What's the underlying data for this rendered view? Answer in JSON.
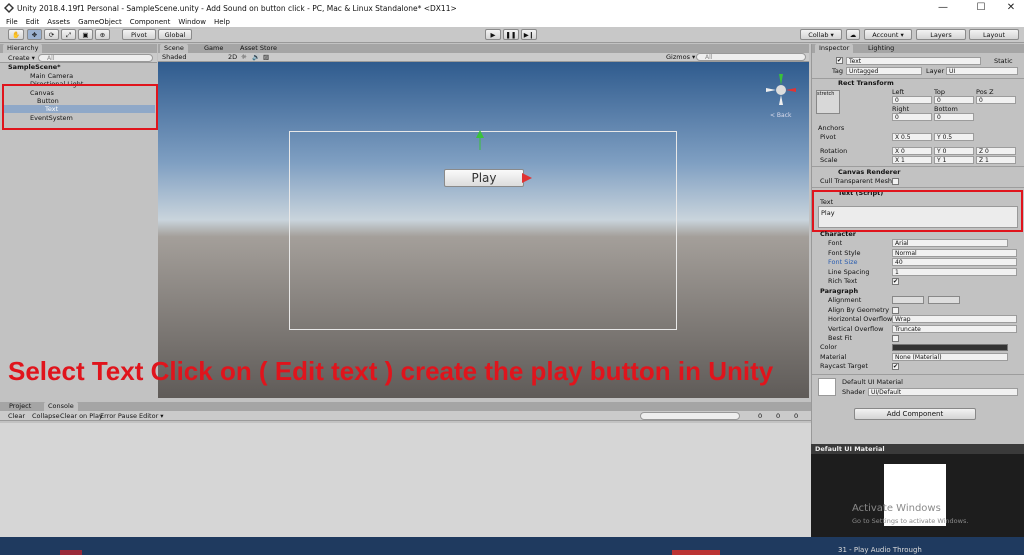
{
  "window": {
    "title": "Unity 2018.4.19f1 Personal - SampleScene.unity - Add Sound on button click - PC, Mac & Linux Standalone* <DX11>",
    "minimize": "—",
    "maximize": "☐",
    "close": "✕"
  },
  "menu": [
    "File",
    "Edit",
    "Assets",
    "GameObject",
    "Component",
    "Window",
    "Help"
  ],
  "toolbar": {
    "pivot": "Pivot",
    "global": "Global",
    "collab": "Collab ▾",
    "account": "Account ▾",
    "layers": "Layers",
    "layout": "Layout"
  },
  "hierarchy": {
    "tab": "Hierarchy",
    "create": "Create ▾",
    "search_placeholder": "All",
    "scene": "SampleScene*",
    "items": [
      {
        "label": "Main Camera",
        "indent": 1,
        "selected": false
      },
      {
        "label": "Directional Light",
        "indent": 1,
        "selected": false
      },
      {
        "label": "Canvas",
        "indent": 1,
        "selected": false
      },
      {
        "label": "Button",
        "indent": 2,
        "selected": false
      },
      {
        "label": "Text",
        "indent": 3,
        "selected": true
      },
      {
        "label": "EventSystem",
        "indent": 1,
        "selected": false
      }
    ]
  },
  "scene_view": {
    "tabs": [
      "Scene",
      "Game",
      "Asset Store"
    ],
    "shading": "Shaded",
    "mode2d": "2D",
    "gizmos": "Gizmos ▾",
    "search_placeholder": "All",
    "back_label": "< Back",
    "button_text": "Play"
  },
  "overlay_caption": "Select Text Click on ( Edit text ) create the play button in Unity",
  "console": {
    "tabs": [
      "Project",
      "Console"
    ],
    "buttons": [
      "Clear",
      "Collapse",
      "Clear on Play",
      "Error Pause",
      "Editor ▾"
    ],
    "counts": [
      "0",
      "0",
      "0"
    ]
  },
  "inspector": {
    "tabs": [
      "Inspector",
      "Lighting"
    ],
    "object_name": "Text",
    "static": "Static",
    "tag_label": "Tag",
    "tag_value": "Untagged",
    "layer_label": "Layer",
    "layer_value": "UI",
    "rect_transform": {
      "title": "Rect Transform",
      "stretch": "stretch",
      "cols1": [
        "Left",
        "Top",
        "Pos Z"
      ],
      "vals1": [
        "0",
        "0",
        "0"
      ],
      "cols2": [
        "Right",
        "Bottom"
      ],
      "vals2": [
        "0",
        "0"
      ],
      "anchors": "Anchors",
      "pivot_label": "Pivot",
      "pivot": [
        "X 0.5",
        "Y 0.5"
      ],
      "rotation_label": "Rotation",
      "rotation": [
        "X 0",
        "Y 0",
        "Z 0"
      ],
      "scale_label": "Scale",
      "scale": [
        "X 1",
        "Y 1",
        "Z 1"
      ]
    },
    "canvas_renderer": {
      "title": "Canvas Renderer",
      "cull": "Cull Transparent Mesh"
    },
    "text_script": {
      "title": "Text (Script)",
      "text_label": "Text",
      "text_value": "Play",
      "character": "Character",
      "rows": [
        {
          "label": "Font",
          "value": "Arial"
        },
        {
          "label": "Font Style",
          "value": "Normal"
        },
        {
          "label": "Font Size",
          "value": "40"
        },
        {
          "label": "Line Spacing",
          "value": "1"
        },
        {
          "label": "Rich Text",
          "value": "✔"
        }
      ],
      "paragraph": "Paragraph",
      "prows": [
        {
          "label": "Alignment",
          "value": ""
        },
        {
          "label": "Align By Geometry",
          "value": ""
        },
        {
          "label": "Horizontal Overflow",
          "value": "Wrap"
        },
        {
          "label": "Vertical Overflow",
          "value": "Truncate"
        },
        {
          "label": "Best Fit",
          "value": ""
        },
        {
          "label": "Color",
          "value": ""
        },
        {
          "label": "Material",
          "value": "None (Material)"
        },
        {
          "label": "Raycast Target",
          "value": "✔"
        }
      ]
    },
    "material": {
      "name": "Default UI Material",
      "shader_label": "Shader",
      "shader_value": "UI/Default"
    },
    "add_component": "Add Component",
    "preview_title": "Default UI Material"
  },
  "watermark": {
    "line1": "Activate Windows",
    "line2": "Go to Settings to activate Windows."
  },
  "taskbar": {
    "item": "31 - Play Audio Through"
  },
  "colors": {
    "highlight": "#e0141c",
    "selection": "#8fa8c8",
    "tabbar": "#a5a5a5",
    "panel": "#c2c2c2"
  }
}
